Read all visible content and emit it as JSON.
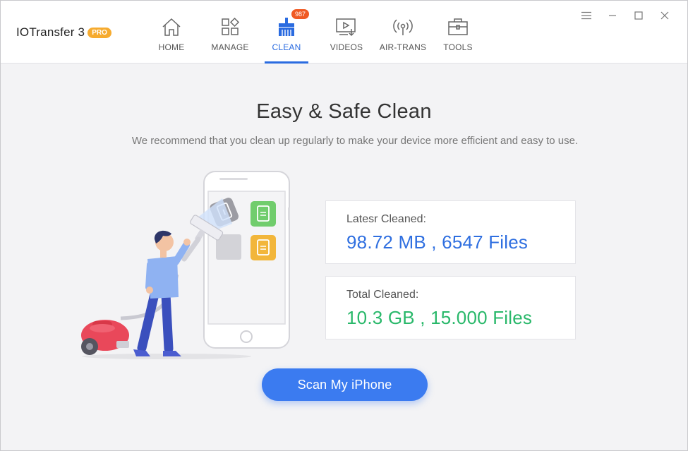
{
  "app": {
    "name": "IOTransfer 3",
    "badge": "PRO"
  },
  "nav": {
    "items": [
      {
        "label": "HOME",
        "icon": "home-icon"
      },
      {
        "label": "MANAGE",
        "icon": "manage-icon"
      },
      {
        "label": "CLEAN",
        "icon": "broom-icon",
        "badge": "987",
        "active": true
      },
      {
        "label": "VIDEOS",
        "icon": "video-icon"
      },
      {
        "label": "AIR-TRANS",
        "icon": "wireless-icon"
      },
      {
        "label": "TOOLS",
        "icon": "toolbox-icon"
      }
    ]
  },
  "window_controls": [
    "menu-icon",
    "minimize-icon",
    "maximize-icon",
    "close-icon"
  ],
  "main": {
    "title": "Easy & Safe Clean",
    "subtitle": "We recommend that you clean up regularly to make your device more efficient and easy to use.",
    "latest": {
      "label": "Latesr Cleaned:",
      "value": "98.72 MB , 6547 Files"
    },
    "total": {
      "label": "Total Cleaned:",
      "value": "10.3 GB , 15.000 Files"
    },
    "scan_button": "Scan My iPhone"
  },
  "colors": {
    "accent": "#2a6be0",
    "badge": "#f05a23",
    "pro": "#f6ab2f",
    "latest_value": "#2f6fe0",
    "total_value": "#29b86a",
    "button": "#3b7bf0"
  }
}
